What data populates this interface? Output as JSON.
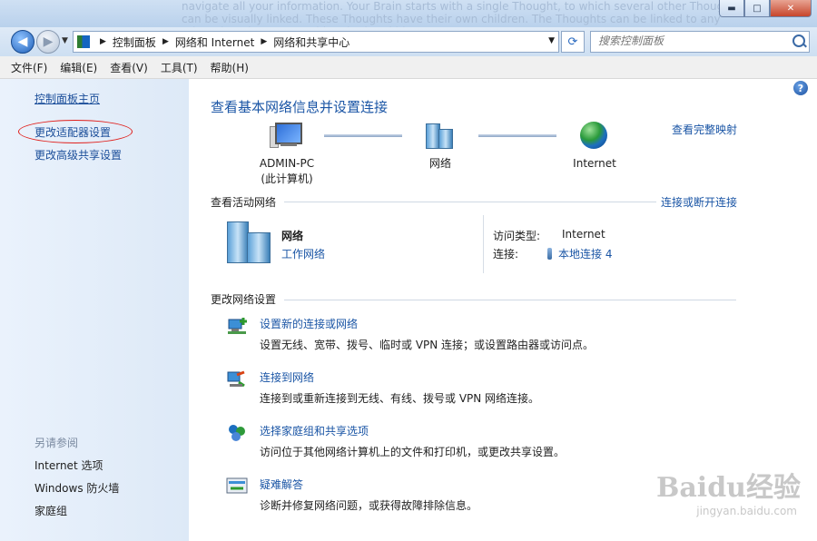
{
  "title_bar": {
    "background_text": "navigate all your information. Your Brain starts with a single Thought, to which several other Thoughts can be visually linked. These Thoughts have their own children. The Thoughts can be linked to any other Thought, as you add and related ideas",
    "buttons": {
      "minimize": "▬",
      "maximize": "□",
      "close": "✕"
    }
  },
  "address_bar": {
    "crumbs": [
      "控制面板",
      "网络和 Internet",
      "网络和共享中心"
    ],
    "search_placeholder": "搜索控制面板"
  },
  "menu": [
    "文件(F)",
    "编辑(E)",
    "查看(V)",
    "工具(T)",
    "帮助(H)"
  ],
  "sidebar": {
    "home": "控制面板主页",
    "links": [
      "更改适配器设置",
      "更改高级共享设置"
    ],
    "see_also_title": "另请参阅",
    "see_also": [
      "Internet 选项",
      "Windows 防火墙",
      "家庭组"
    ]
  },
  "main": {
    "title": "查看基本网络信息并设置连接",
    "view_full_map": "查看完整映射",
    "nodes": [
      {
        "line1": "ADMIN-PC",
        "line2": "(此计算机)",
        "icon": "computer-icon"
      },
      {
        "line1": "网络",
        "line2": "",
        "icon": "network-icon"
      },
      {
        "line1": "Internet",
        "line2": "",
        "icon": "globe-icon"
      }
    ],
    "active_section": "查看活动网络",
    "connect_disconnect": "连接或断开连接",
    "active_network": {
      "name": "网络",
      "type": "工作网络",
      "access_label": "访问类型:",
      "access_value": "Internet",
      "conn_label": "连接:",
      "conn_value": "本地连接 4"
    },
    "change_section": "更改网络设置",
    "tasks": [
      {
        "link": "设置新的连接或网络",
        "desc": "设置无线、宽带、拨号、临时或 VPN 连接；或设置路由器或访问点。",
        "icon": "new-connection-icon"
      },
      {
        "link": "连接到网络",
        "desc": "连接到或重新连接到无线、有线、拨号或 VPN 网络连接。",
        "icon": "connect-network-icon"
      },
      {
        "link": "选择家庭组和共享选项",
        "desc": "访问位于其他网络计算机上的文件和打印机，或更改共享设置。",
        "icon": "homegroup-icon"
      },
      {
        "link": "疑难解答",
        "desc": "诊断并修复网络问题，或获得故障排除信息。",
        "icon": "troubleshoot-icon"
      }
    ]
  },
  "watermark": {
    "text": "Baidu经验",
    "sub": "jingyan.baidu.com"
  },
  "colors": {
    "link": "#1a55a5",
    "annotation_circle": "#e0201c",
    "sidebar_bg": "#dde9f7"
  }
}
